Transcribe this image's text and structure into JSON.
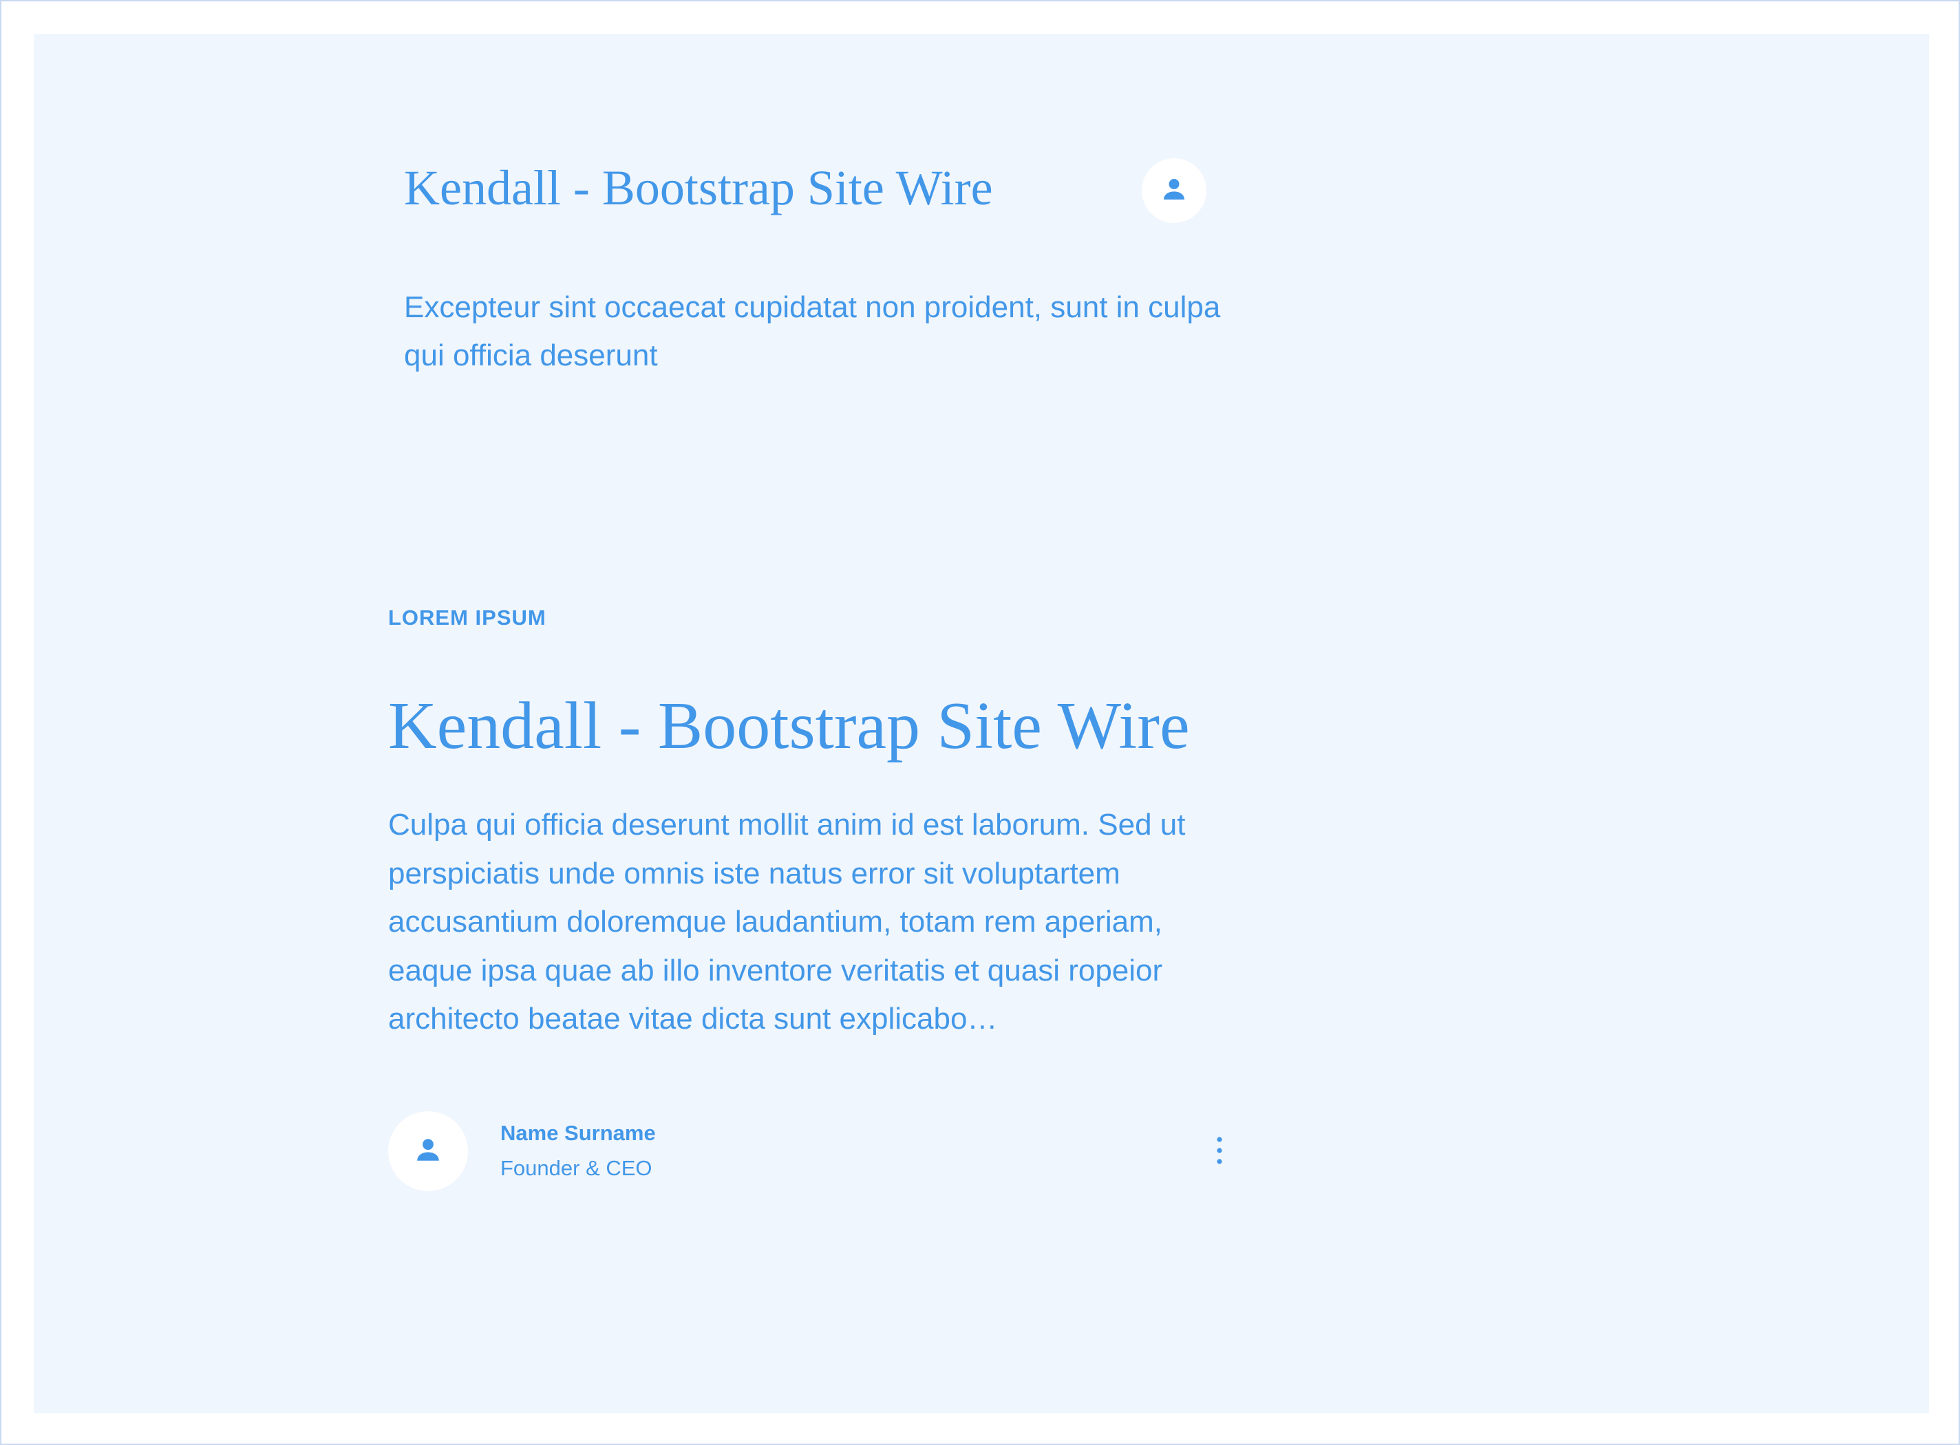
{
  "colors": {
    "accent": "#4297e8",
    "panel_background": "#f0f6fd",
    "avatar_background": "#ffffff"
  },
  "header": {
    "title": "Kendall - Bootstrap Site Wire",
    "subtitle": "Excepteur sint occaecat cupidatat non proident, sunt in culpa qui officia deserunt",
    "avatar_icon": "user-icon"
  },
  "article": {
    "eyebrow": "LOREM IPSUM",
    "title": "Kendall - Bootstrap Site Wire",
    "body": "Culpa qui officia deserunt mollit anim id est laborum. Sed ut perspiciatis unde omnis iste natus error sit voluptartem accusantium doloremque laudantium, totam rem aperiam, eaque ipsa quae ab illo inventore veritatis et quasi ropeior architecto beatae vitae dicta sunt explicabo…"
  },
  "author": {
    "name": "Name Surname",
    "role": "Founder & CEO",
    "avatar_icon": "user-icon",
    "menu_icon": "more-vertical-icon"
  }
}
